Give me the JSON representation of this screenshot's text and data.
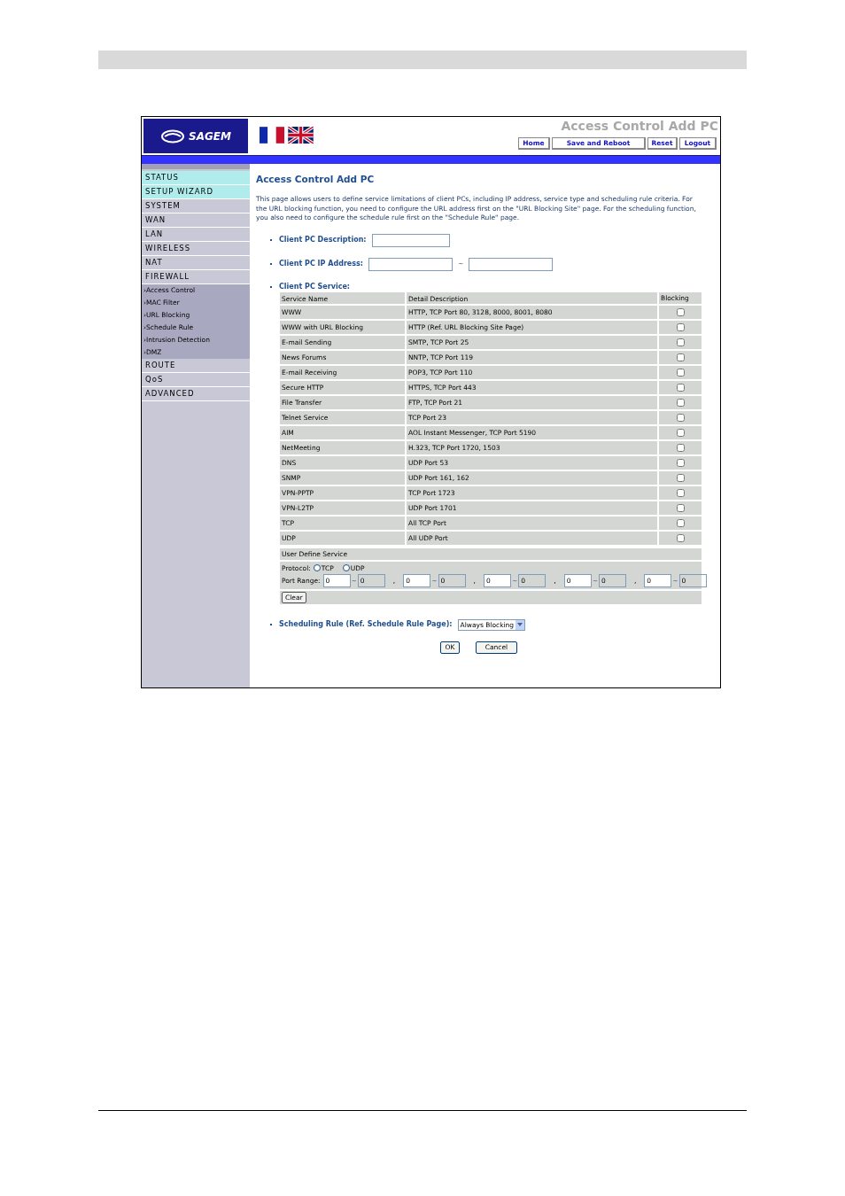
{
  "header": {
    "logo": "SAGEM",
    "page_title": "Access Control Add PC",
    "nav_links": [
      "Home",
      "Save and Reboot",
      "Reset",
      "Logout"
    ]
  },
  "sidebar": {
    "items": [
      {
        "label": "STATUS",
        "highlighted": true
      },
      {
        "label": "SETUP WIZARD",
        "highlighted": true
      },
      {
        "label": "SYSTEM",
        "highlighted": false
      },
      {
        "label": "WAN",
        "highlighted": false
      },
      {
        "label": "LAN",
        "highlighted": false
      },
      {
        "label": "WIRELESS",
        "highlighted": false
      },
      {
        "label": "NAT",
        "highlighted": false
      },
      {
        "label": "FIREWALL",
        "highlighted": false,
        "children": [
          {
            "marker": "›",
            "label": "Access Control"
          },
          {
            "marker": "›",
            "label": "MAC Filter"
          },
          {
            "marker": "›",
            "label": "URL Blocking"
          },
          {
            "marker": "›",
            "label": "Schedule Rule"
          },
          {
            "marker": "›",
            "label": "Intrusion Detection"
          },
          {
            "marker": "›",
            "label": "DMZ"
          }
        ]
      },
      {
        "label": "ROUTE",
        "highlighted": false
      },
      {
        "label": "QoS",
        "highlighted": false
      },
      {
        "label": "ADVANCED",
        "highlighted": false
      }
    ]
  },
  "content": {
    "title": "Access Control Add PC",
    "intro": "This page allows users to define service limitations of client PCs, including IP address, service type and scheduling rule criteria. For the URL blocking function, you need to configure the URL address first on the \"URL Blocking Site\" page. For the scheduling function, you also need to configure the schedule rule first on the \"Schedule Rule\" page.",
    "description_label": "Client PC Description:",
    "ip_label": "Client PC IP Address:",
    "ip_separator": "~",
    "service_label": "Client PC Service:",
    "table": {
      "columns": [
        "Service Name",
        "Detail Description",
        "Blocking"
      ],
      "rows": [
        {
          "name": "WWW",
          "detail": "HTTP, TCP Port 80, 3128, 8000, 8001, 8080",
          "checked": false
        },
        {
          "name": "WWW with URL Blocking",
          "detail": "HTTP (Ref. URL Blocking Site Page)",
          "checked": false
        },
        {
          "name": "E-mail Sending",
          "detail": "SMTP, TCP Port 25",
          "checked": false
        },
        {
          "name": "News Forums",
          "detail": "NNTP, TCP Port 119",
          "checked": false
        },
        {
          "name": "E-mail Receiving",
          "detail": "POP3, TCP Port 110",
          "checked": false
        },
        {
          "name": "Secure HTTP",
          "detail": "HTTPS, TCP Port 443",
          "checked": false
        },
        {
          "name": "File Transfer",
          "detail": "FTP, TCP Port 21",
          "checked": false
        },
        {
          "name": "Telnet Service",
          "detail": "TCP Port 23",
          "checked": false
        },
        {
          "name": "AIM",
          "detail": "AOL Instant Messenger, TCP Port 5190",
          "checked": false
        },
        {
          "name": "NetMeeting",
          "detail": "H.323, TCP Port 1720, 1503",
          "checked": false
        },
        {
          "name": "DNS",
          "detail": "UDP Port 53",
          "checked": false
        },
        {
          "name": "SNMP",
          "detail": "UDP Port 161, 162",
          "checked": false
        },
        {
          "name": "VPN-PPTP",
          "detail": "TCP Port 1723",
          "checked": false
        },
        {
          "name": "VPN-L2TP",
          "detail": "UDP Port 1701",
          "checked": false
        },
        {
          "name": "TCP",
          "detail": "All TCP Port",
          "checked": false
        },
        {
          "name": "UDP",
          "detail": "All UDP Port",
          "checked": false
        }
      ]
    },
    "user_define": {
      "title": "User Define Service",
      "protocol_label": "Protocol:",
      "protocols": [
        {
          "label": "TCP",
          "selected": false
        },
        {
          "label": "UDP",
          "selected": false
        }
      ],
      "port_range_label": "Port Range:",
      "range_separator": "~",
      "list_separator": ",",
      "ranges": [
        {
          "from": "0",
          "to": "0"
        },
        {
          "from": "0",
          "to": "0"
        },
        {
          "from": "0",
          "to": "0"
        },
        {
          "from": "0",
          "to": "0"
        },
        {
          "from": "0",
          "to": "0"
        }
      ],
      "clear_button": "Clear"
    },
    "schedule_label": "Scheduling Rule (Ref. Schedule Rule Page):",
    "schedule_value": "Always Blocking",
    "buttons": [
      "OK",
      "Cancel"
    ]
  }
}
